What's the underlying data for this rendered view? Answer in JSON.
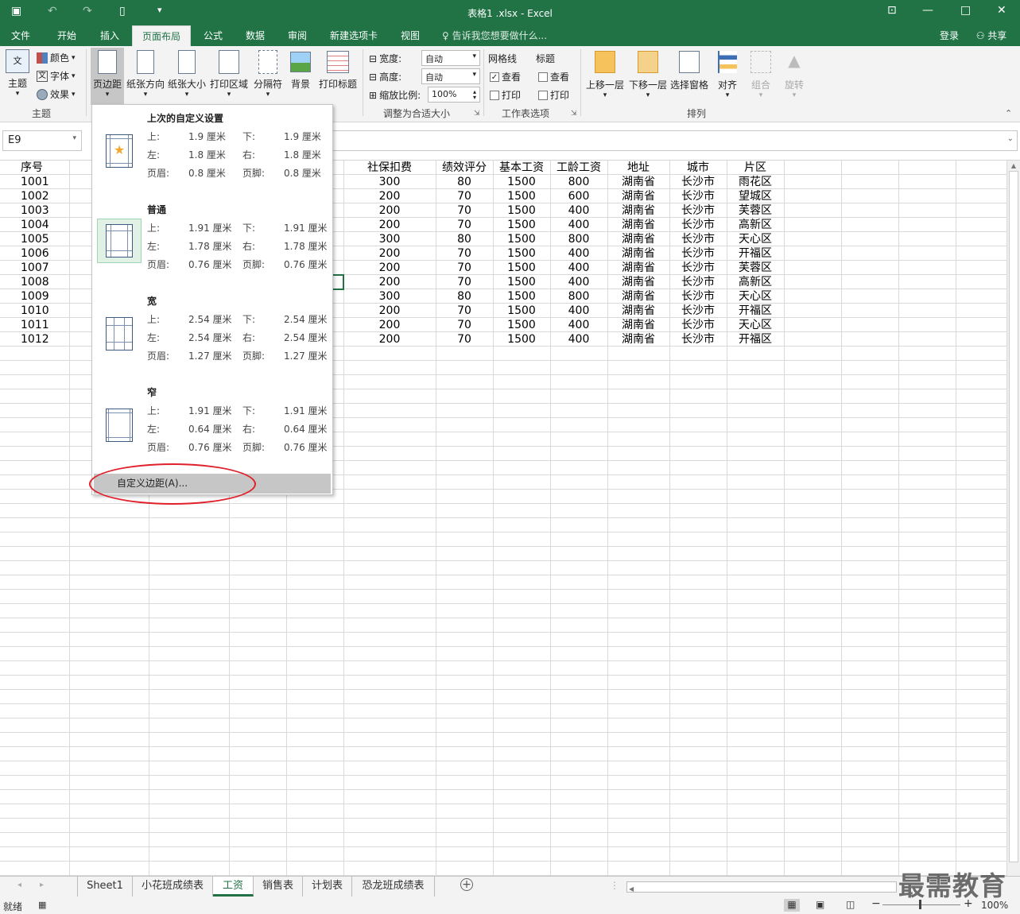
{
  "window": {
    "title": "表格1 .xlsx - Excel",
    "login": "登录",
    "share": "共享"
  },
  "tabs": [
    "文件",
    "开始",
    "插入",
    "页面布局",
    "公式",
    "数据",
    "审阅",
    "新建选项卡",
    "视图"
  ],
  "tell_me": "告诉我您想要做什么...",
  "ribbon": {
    "theme": {
      "label": "主题",
      "colors": "颜色",
      "fonts": "字体",
      "effects": "效果",
      "group": "主题"
    },
    "page_setup": {
      "margins": "页边距",
      "orientation": "纸张方向",
      "size": "纸张大小",
      "print_area": "打印区域",
      "breaks": "分隔符",
      "background": "背景",
      "print_titles": "打印标题"
    },
    "scale": {
      "width_label": "宽度:",
      "width_val": "自动",
      "height_label": "高度:",
      "height_val": "自动",
      "scale_label": "缩放比例:",
      "scale_val": "100%",
      "group": "调整为合适大小"
    },
    "sheet_opts": {
      "gridlines": "网格线",
      "headings": "标题",
      "view": "查看",
      "print": "打印",
      "group": "工作表选项"
    },
    "arrange": {
      "forward": "上移一层",
      "backward": "下移一层",
      "selection": "选择窗格",
      "align": "对齐",
      "group_btn": "组合",
      "rotate": "旋转",
      "group": "排列"
    }
  },
  "name_box": "E9",
  "headers": [
    "序号",
    "社保扣费",
    "绩效评分",
    "基本工资",
    "工龄工资",
    "地址",
    "城市",
    "片区"
  ],
  "rows": [
    [
      "1001",
      "300",
      "80",
      "1500",
      "800",
      "湖南省",
      "长沙市",
      "雨花区"
    ],
    [
      "1002",
      "200",
      "70",
      "1500",
      "600",
      "湖南省",
      "长沙市",
      "望城区"
    ],
    [
      "1003",
      "200",
      "70",
      "1500",
      "400",
      "湖南省",
      "长沙市",
      "芙蓉区"
    ],
    [
      "1004",
      "200",
      "70",
      "1500",
      "400",
      "湖南省",
      "长沙市",
      "高新区"
    ],
    [
      "1005",
      "300",
      "80",
      "1500",
      "800",
      "湖南省",
      "长沙市",
      "天心区"
    ],
    [
      "1006",
      "200",
      "70",
      "1500",
      "400",
      "湖南省",
      "长沙市",
      "开福区"
    ],
    [
      "1007",
      "200",
      "70",
      "1500",
      "400",
      "湖南省",
      "长沙市",
      "芙蓉区"
    ],
    [
      "1008",
      "200",
      "70",
      "1500",
      "400",
      "湖南省",
      "长沙市",
      "高新区"
    ],
    [
      "1009",
      "300",
      "80",
      "1500",
      "800",
      "湖南省",
      "长沙市",
      "天心区"
    ],
    [
      "1010",
      "200",
      "70",
      "1500",
      "400",
      "湖南省",
      "长沙市",
      "开福区"
    ],
    [
      "1011",
      "200",
      "70",
      "1500",
      "400",
      "湖南省",
      "长沙市",
      "天心区"
    ],
    [
      "1012",
      "200",
      "70",
      "1500",
      "400",
      "湖南省",
      "长沙市",
      "开福区"
    ]
  ],
  "menu": {
    "groups": [
      {
        "title": "上次的自定义设置",
        "top_l": "上:",
        "top": "1.9 厘米",
        "bottom_l": "下:",
        "bottom": "1.9 厘米",
        "left_l": "左:",
        "left": "1.8 厘米",
        "right_l": "右:",
        "right": "1.8 厘米",
        "header_l": "页眉:",
        "header": "0.8 厘米",
        "footer_l": "页脚:",
        "footer": "0.8 厘米"
      },
      {
        "title": "普通",
        "top_l": "上:",
        "top": "1.91 厘米",
        "bottom_l": "下:",
        "bottom": "1.91 厘米",
        "left_l": "左:",
        "left": "1.78 厘米",
        "right_l": "右:",
        "right": "1.78 厘米",
        "header_l": "页眉:",
        "header": "0.76 厘米",
        "footer_l": "页脚:",
        "footer": "0.76 厘米"
      },
      {
        "title": "宽",
        "top_l": "上:",
        "top": "2.54 厘米",
        "bottom_l": "下:",
        "bottom": "2.54 厘米",
        "left_l": "左:",
        "left": "2.54 厘米",
        "right_l": "右:",
        "right": "2.54 厘米",
        "header_l": "页眉:",
        "header": "1.27 厘米",
        "footer_l": "页脚:",
        "footer": "1.27 厘米"
      },
      {
        "title": "窄",
        "top_l": "上:",
        "top": "1.91 厘米",
        "bottom_l": "下:",
        "bottom": "1.91 厘米",
        "left_l": "左:",
        "left": "0.64 厘米",
        "right_l": "右:",
        "right": "0.64 厘米",
        "header_l": "页眉:",
        "header": "0.76 厘米",
        "footer_l": "页脚:",
        "footer": "0.76 厘米"
      }
    ],
    "custom": "自定义边距(A)..."
  },
  "sheets": [
    "Sheet1",
    "小花班成绩表",
    "工资",
    "销售表",
    "计划表",
    "恐龙班成绩表"
  ],
  "status": {
    "ready": "就绪",
    "zoom": "100%"
  },
  "watermark": "最需教育"
}
